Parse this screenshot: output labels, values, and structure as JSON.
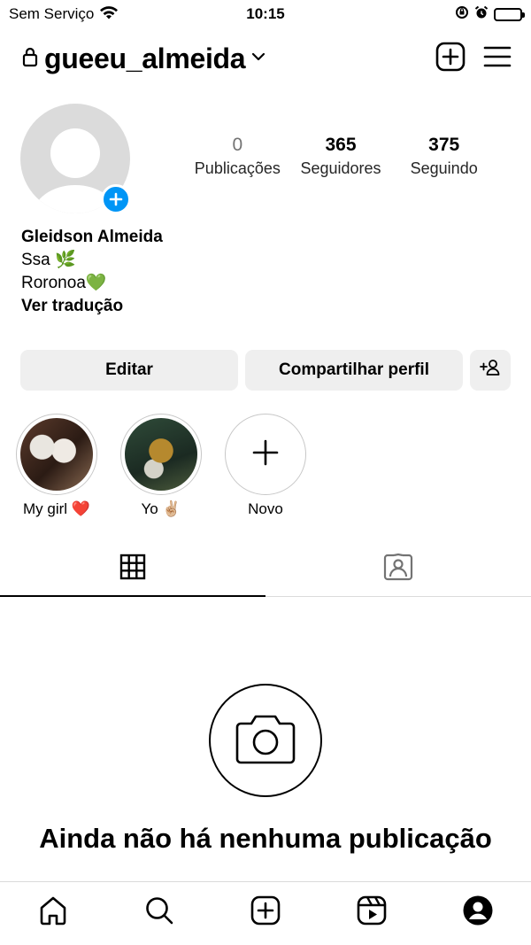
{
  "status_bar": {
    "carrier": "Sem Serviço",
    "time": "10:15"
  },
  "header": {
    "username": "gueeu_almeida"
  },
  "profile": {
    "stats": [
      {
        "value": "0",
        "label": "Publicações"
      },
      {
        "value": "365",
        "label": "Seguidores"
      },
      {
        "value": "375",
        "label": "Seguindo"
      }
    ],
    "name": "Gleidson Almeida",
    "bio_line1": "Ssa 🌿",
    "bio_line2": "Roronoa💚",
    "translate": "Ver tradução"
  },
  "buttons": {
    "edit": "Editar",
    "share": "Compartilhar perfil"
  },
  "highlights": [
    {
      "label": "My girl ❤️"
    },
    {
      "label": "Yo ✌🏼"
    },
    {
      "label": "Novo"
    }
  ],
  "empty_state": {
    "title": "Ainda não há nenhuma publicação"
  },
  "icons": {
    "lock": "lock-icon",
    "chevron": "chevron-down-icon",
    "create": "plus-square-icon",
    "menu": "hamburger-menu-icon",
    "grid": "grid-icon",
    "tagged": "tagged-person-icon",
    "camera": "camera-icon",
    "home": "home-icon",
    "search": "search-icon",
    "reels": "reels-icon",
    "profile": "profile-icon"
  },
  "colors": {
    "accent": "#0095f6",
    "button_bg": "#efefef"
  }
}
